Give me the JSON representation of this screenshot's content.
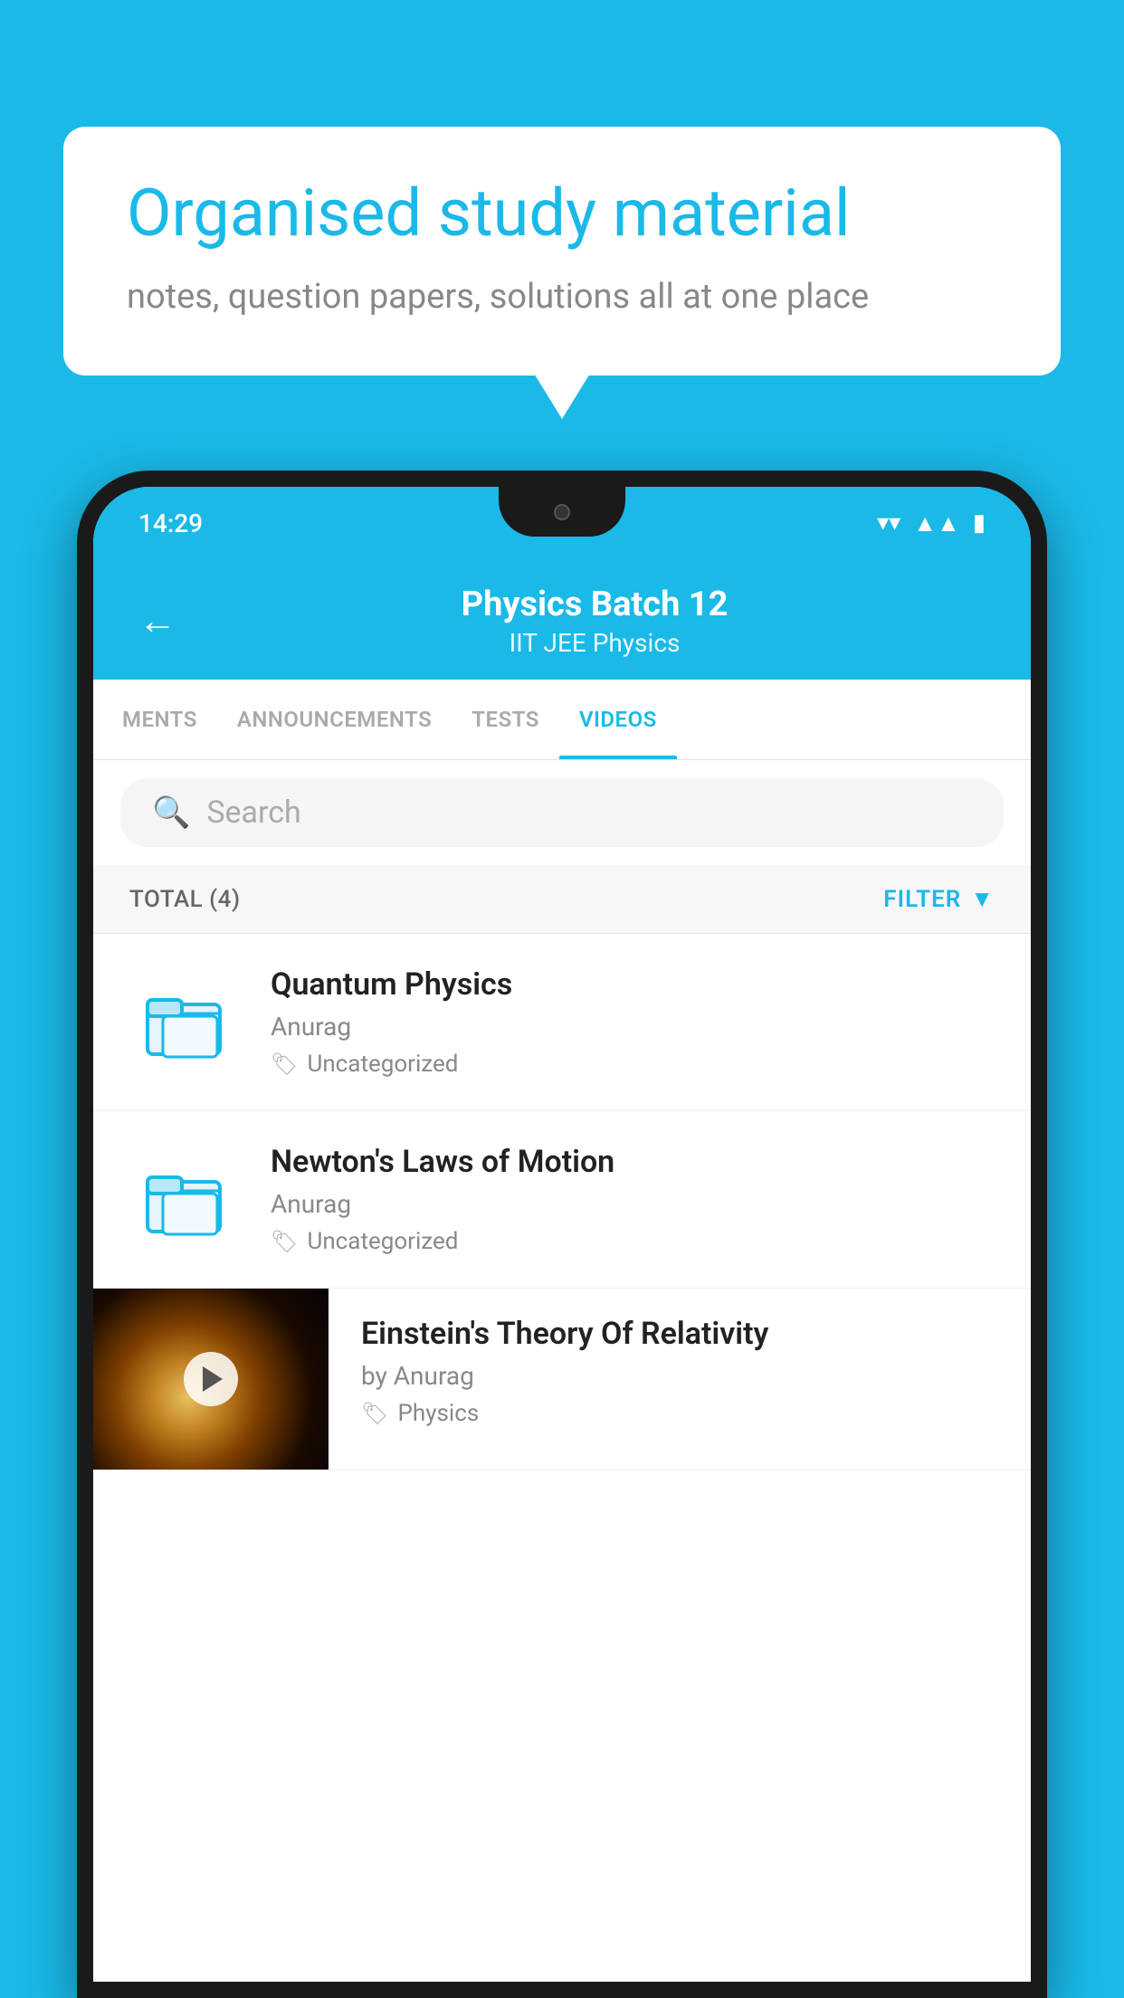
{
  "background_color": "#1ab9e8",
  "speech_bubble": {
    "heading": "Organised study material",
    "subtext": "notes, question papers, solutions all at one place"
  },
  "status_bar": {
    "time": "14:29",
    "icons": [
      "wifi",
      "signal",
      "battery"
    ]
  },
  "header": {
    "title": "Physics Batch 12",
    "subtitle": "IIT JEE   Physics",
    "back_label": "←"
  },
  "tabs": [
    {
      "label": "MENTS",
      "active": false
    },
    {
      "label": "ANNOUNCEMENTS",
      "active": false
    },
    {
      "label": "TESTS",
      "active": false
    },
    {
      "label": "VIDEOS",
      "active": true
    }
  ],
  "search": {
    "placeholder": "Search"
  },
  "filter_row": {
    "total_label": "TOTAL (4)",
    "filter_label": "FILTER"
  },
  "videos": [
    {
      "title": "Quantum Physics",
      "author": "Anurag",
      "tag": "Uncategorized",
      "has_thumbnail": false
    },
    {
      "title": "Newton's Laws of Motion",
      "author": "Anurag",
      "tag": "Uncategorized",
      "has_thumbnail": false
    },
    {
      "title": "Einstein's Theory Of Relativity",
      "author_prefix": "by",
      "author": "Anurag",
      "tag": "Physics",
      "has_thumbnail": true
    }
  ]
}
